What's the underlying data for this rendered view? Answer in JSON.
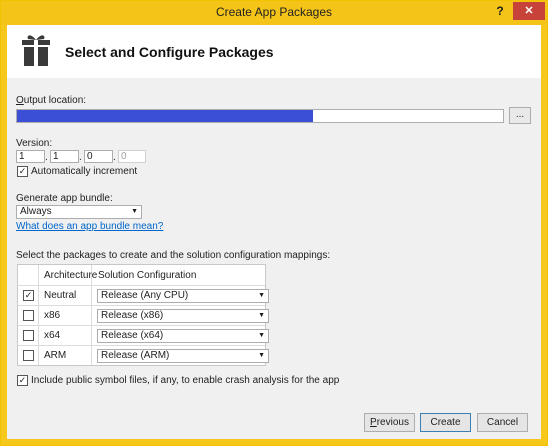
{
  "window": {
    "title": "Create App Packages",
    "help_label": "?",
    "close_label": "✕"
  },
  "header": {
    "title": "Select and Configure Packages",
    "icon": "package-icon"
  },
  "output": {
    "label": "Output location:",
    "progress": 0.61,
    "browse_label": "..."
  },
  "version": {
    "label": "Version:",
    "parts": [
      "1",
      "1",
      "0",
      "0"
    ],
    "separator": ".",
    "auto_increment_label": "Automatically increment",
    "auto_increment": true
  },
  "bundle": {
    "label": "Generate app bundle:",
    "value": "Always",
    "link": "What does an app bundle mean?"
  },
  "packages": {
    "label": "Select the packages to create and the solution configuration mappings:",
    "columns": [
      "Architecture",
      "Solution Configuration"
    ],
    "rows": [
      {
        "checked": true,
        "arch": "Neutral",
        "config": "Release (Any CPU)"
      },
      {
        "checked": false,
        "arch": "x86",
        "config": "Release (x86)"
      },
      {
        "checked": false,
        "arch": "x64",
        "config": "Release (x64)"
      },
      {
        "checked": false,
        "arch": "ARM",
        "config": "Release (ARM)"
      }
    ]
  },
  "symbols": {
    "checked": true,
    "label": "Include public symbol files, if any, to enable crash analysis for the app"
  },
  "buttons": {
    "previous": "Previous",
    "create": "Create",
    "cancel": "Cancel"
  },
  "colors": {
    "titlebar": "#f5c419",
    "progress": "#3a4fd6",
    "close": "#c7433a",
    "link": "#0066cc"
  }
}
